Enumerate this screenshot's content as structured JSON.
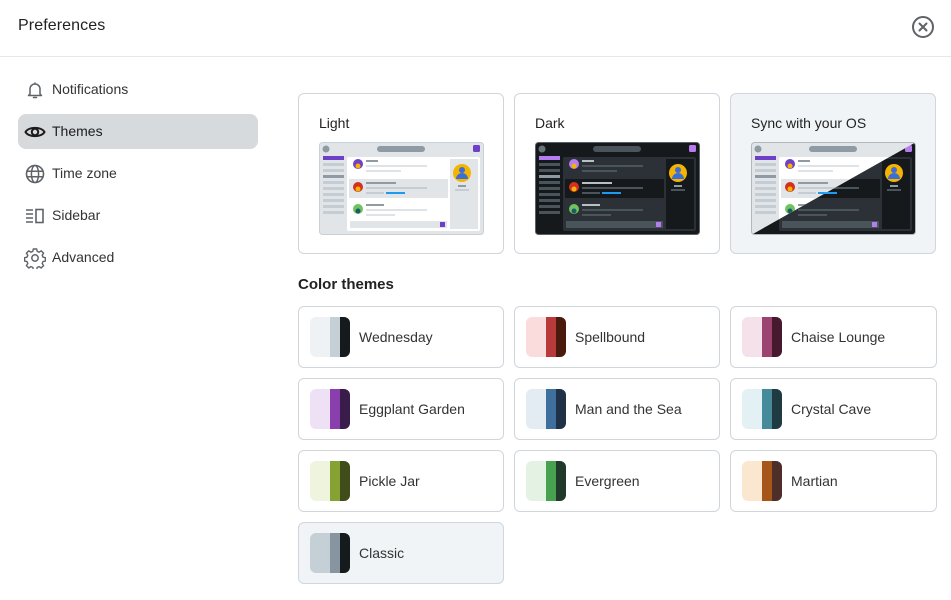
{
  "header": {
    "title": "Preferences",
    "close_icon": "close-circle-icon"
  },
  "sidebar": {
    "items": [
      {
        "label": "Notifications",
        "icon": "bell-icon",
        "active": false
      },
      {
        "label": "Themes",
        "icon": "eye-icon",
        "active": true
      },
      {
        "label": "Time zone",
        "icon": "globe-icon",
        "active": false
      },
      {
        "label": "Sidebar",
        "icon": "sidebar-icon",
        "active": false
      },
      {
        "label": "Advanced",
        "icon": "gear-icon",
        "active": false
      }
    ]
  },
  "modes": {
    "items": [
      {
        "label": "Light",
        "selected": false
      },
      {
        "label": "Dark",
        "selected": false
      },
      {
        "label": "Sync with your OS",
        "selected": true
      }
    ]
  },
  "color_themes": {
    "title": "Color themes",
    "items": [
      {
        "name": "Wednesday",
        "colors": [
          "#eef2f5",
          "#c4cfd6",
          "#151a1d"
        ],
        "selected": false
      },
      {
        "name": "Spellbound",
        "colors": [
          "#fbdcdc",
          "#b83a3a",
          "#4a1a0c"
        ],
        "selected": false
      },
      {
        "name": "Chaise Lounge",
        "colors": [
          "#f4e1ea",
          "#9b4471",
          "#46192f"
        ],
        "selected": false
      },
      {
        "name": "Eggplant Garden",
        "colors": [
          "#eee1f6",
          "#8a3fae",
          "#3a1c4a"
        ],
        "selected": false
      },
      {
        "name": "Man and the Sea",
        "colors": [
          "#e3ebf3",
          "#3f6f9c",
          "#1f3146"
        ],
        "selected": false
      },
      {
        "name": "Crystal Cave",
        "colors": [
          "#e3f0f4",
          "#458b9c",
          "#1f3a40"
        ],
        "selected": false
      },
      {
        "name": "Pickle Jar",
        "colors": [
          "#eef4dd",
          "#85a232",
          "#404d1a"
        ],
        "selected": false
      },
      {
        "name": "Evergreen",
        "colors": [
          "#e4f2e4",
          "#48a14f",
          "#21392a"
        ],
        "selected": false
      },
      {
        "name": "Martian",
        "colors": [
          "#fbe7cf",
          "#a55618",
          "#4e2e29"
        ],
        "selected": false
      },
      {
        "name": "Classic",
        "colors": [
          "#c4cfd6",
          "#8795a0",
          "#151a1d"
        ],
        "selected": true
      }
    ]
  },
  "colors": {
    "accent_purple": "#6e3fc7",
    "accent_blue": "#1d9bf0",
    "avatar_yellow": "#f5b400",
    "avatar_blue": "#3b6fd6"
  }
}
